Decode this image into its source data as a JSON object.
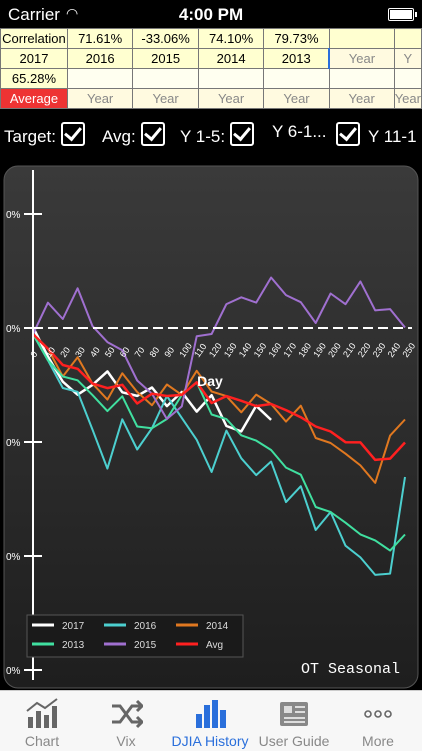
{
  "status": {
    "carrier": "Carrier",
    "time": "4:00 PM"
  },
  "table": {
    "row1": [
      "Correlation",
      "71.61%",
      "-33.06%",
      "74.10%",
      "79.73%",
      "",
      ""
    ],
    "row2": [
      "2017",
      "2016",
      "2015",
      "2014",
      "2013",
      "Year",
      "Y"
    ],
    "row3": [
      "65.28%",
      "",
      "",
      "",
      "",
      "",
      ""
    ],
    "row4": [
      "Average",
      "Year",
      "Year",
      "Year",
      "Year",
      "Year",
      "Year"
    ]
  },
  "options": {
    "target": "Target:",
    "avg": "Avg:",
    "y1_5": "Y 1-5:",
    "y6_10": "Y 6-1...",
    "y11": "Y 11-1"
  },
  "chart_data": {
    "type": "line",
    "xlabel": "Day",
    "xticks": [
      "0",
      "10",
      "20",
      "30",
      "40",
      "50",
      "60",
      "70",
      "80",
      "90",
      "100",
      "110",
      "120",
      "130",
      "140",
      "150",
      "160",
      "170",
      "180",
      "190",
      "200",
      "210",
      "220",
      "230",
      "240",
      "250"
    ],
    "yticks": [
      "0%",
      "0%",
      "0%",
      "0%",
      "0%"
    ],
    "watermark": "OT Seasonal",
    "series": [
      {
        "name": "2017",
        "color": "#ffffff",
        "values": [
          0,
          -2,
          -5,
          -6,
          -5,
          -4,
          -5,
          -6,
          -5,
          -7,
          -6,
          -7,
          -6,
          -8,
          -9,
          -7,
          -8
        ]
      },
      {
        "name": "2016",
        "color": "#4ccfcf",
        "values": [
          0,
          -3,
          -5,
          -6,
          -9,
          -12,
          -8,
          -10,
          -9,
          -6,
          -8,
          -10,
          -12,
          -9,
          -11,
          -13,
          -12,
          -15,
          -14,
          -17,
          -16,
          -19,
          -20,
          -22,
          -21,
          -13
        ]
      },
      {
        "name": "2014",
        "color": "#e07820",
        "values": [
          0,
          -2,
          -4,
          -3,
          -5,
          -6,
          -4,
          -5,
          -7,
          -5,
          -6,
          -4,
          -5,
          -6,
          -7,
          -6,
          -7,
          -8,
          -7,
          -9,
          -10,
          -11,
          -12,
          -14,
          -9,
          -8
        ]
      },
      {
        "name": "2013",
        "color": "#40e0a0",
        "values": [
          0,
          -3,
          -4,
          -5,
          -6,
          -7,
          -6,
          -8,
          -9,
          -8,
          -6,
          -5,
          -7,
          -8,
          -9,
          -10,
          -11,
          -12,
          -13,
          -15,
          -16,
          -17,
          -18,
          -19,
          -19,
          -18
        ]
      },
      {
        "name": "2015",
        "color": "#a070d0",
        "values": [
          0,
          2,
          1,
          3,
          0,
          -1,
          -2,
          -4,
          -6,
          -8,
          -7,
          -1,
          0,
          2,
          3,
          2,
          4,
          3,
          2,
          1,
          3,
          2,
          4,
          1,
          2,
          0
        ]
      },
      {
        "name": "Avg",
        "color": "#ff2020",
        "values": [
          0,
          -2,
          -3,
          -4,
          -5,
          -5,
          -5,
          -6,
          -6,
          -6,
          -6,
          -5,
          -6,
          -6,
          -6,
          -7,
          -7,
          -7,
          -8,
          -8,
          -9,
          -10,
          -10,
          -12,
          -11,
          -10
        ]
      }
    ]
  },
  "tabs": [
    {
      "label": "Chart",
      "icon": "line-chart-icon"
    },
    {
      "label": "Vix",
      "icon": "shuffle-icon"
    },
    {
      "label": "DJIA History",
      "icon": "bar-chart-icon"
    },
    {
      "label": "User Guide",
      "icon": "newspaper-icon"
    },
    {
      "label": "More",
      "icon": "more-icon"
    }
  ]
}
